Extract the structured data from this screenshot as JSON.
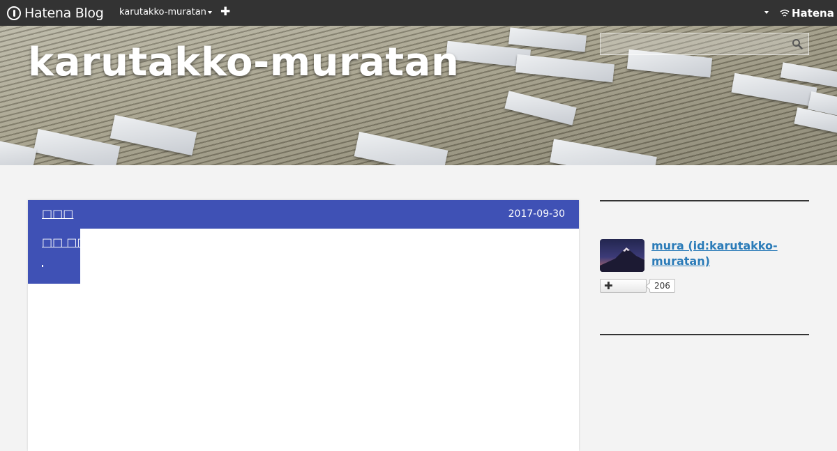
{
  "globalheader": {
    "brand": "Hatena Blog",
    "blog_switcher": "karutakko-muratan",
    "hatena_logo": "Hatena",
    "icons": [
      "hatena-blog-icon",
      "plus-icon",
      "chevron-down-icon",
      "hatena-logo-icon"
    ]
  },
  "header": {
    "blog_title": "karutakko-muratan",
    "search": {
      "placeholder": "",
      "value": ""
    }
  },
  "entry": {
    "category": "□□□",
    "date": "2017-09-30",
    "sub_title": "□□ □□",
    "accent_color": "#3f51b5"
  },
  "sidebar": {
    "profile": {
      "name": "mura (id:karutakko-muratan)",
      "follower_count": "206",
      "name_color": "#2a7bb8"
    }
  }
}
